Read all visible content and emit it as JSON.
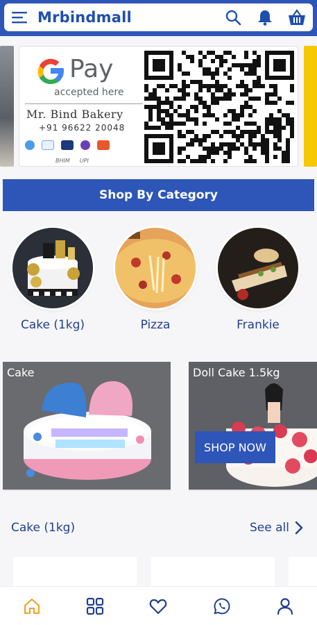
{
  "header": {
    "title": "Mrbindmall",
    "icons": [
      "menu-icon",
      "search-icon",
      "bell-icon",
      "basket-icon"
    ]
  },
  "banner": {
    "gpay_word": "Pay",
    "gpay_sub": "accepted here",
    "business_name": "Mr. Bind Bakery",
    "phone": "+91 96622 20048",
    "footer_logos": [
      "BHIM",
      "UPI"
    ]
  },
  "shop_by_category": {
    "heading": "Shop By Category",
    "items": [
      {
        "label": "Cake (1kg)"
      },
      {
        "label": "Pizza"
      },
      {
        "label": "Frankie"
      }
    ]
  },
  "promos": [
    {
      "title": "Cake"
    },
    {
      "title": "Doll Cake 1.5kg",
      "cta": "SHOP NOW"
    }
  ],
  "section": {
    "title": "Cake (1kg)",
    "see_all": "See all"
  },
  "bottom_nav": {
    "items": [
      "home-icon",
      "grid-icon",
      "heart-icon",
      "whatsapp-icon",
      "user-icon"
    ],
    "active_color": "#f0a020",
    "inactive_color": "#1f3f8f"
  },
  "colors": {
    "brand_blue": "#2e55b8",
    "text_blue": "#1f3f8f"
  }
}
